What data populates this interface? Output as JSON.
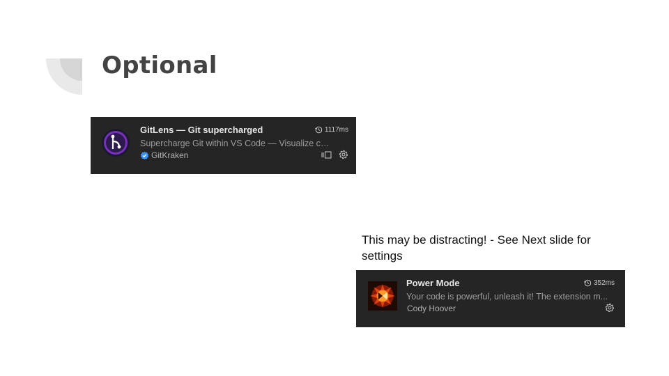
{
  "slide": {
    "title": "Optional",
    "note": "This may be distracting! - See Next slide for settings"
  },
  "extensions": [
    {
      "name": "GitLens — Git supercharged",
      "timing": "1117ms",
      "description": "Supercharge Git within VS Code — Visualize code ...",
      "publisher": "GitKraken",
      "publisher_verified": true,
      "logo": "gitlens-logo",
      "actions": [
        "split-editor-icon",
        "gear-icon"
      ]
    },
    {
      "name": "Power Mode",
      "timing": "352ms",
      "description": "Your code is powerful, unleash it! The extension m...",
      "publisher": "Cody Hoover",
      "publisher_verified": false,
      "logo": "power-mode-logo",
      "actions": [
        "gear-icon"
      ]
    }
  ],
  "colors": {
    "card_bg": "#252526",
    "title": "#434343",
    "verified_badge": "#3794ff"
  }
}
